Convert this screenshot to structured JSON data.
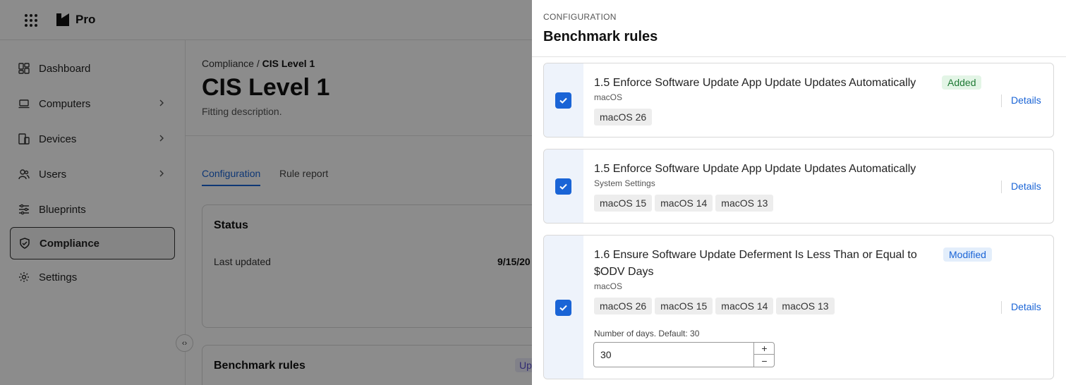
{
  "app": {
    "brand": "Pro"
  },
  "sidebar": {
    "items": [
      {
        "label": "Dashboard",
        "icon": "dashboard-icon",
        "has_children": false,
        "active": false
      },
      {
        "label": "Computers",
        "icon": "laptop-icon",
        "has_children": true,
        "active": false
      },
      {
        "label": "Devices",
        "icon": "devices-icon",
        "has_children": true,
        "active": false
      },
      {
        "label": "Users",
        "icon": "users-icon",
        "has_children": true,
        "active": false
      },
      {
        "label": "Blueprints",
        "icon": "sliders-icon",
        "has_children": false,
        "active": false
      },
      {
        "label": "Compliance",
        "icon": "shield-icon",
        "has_children": false,
        "active": true
      },
      {
        "label": "Settings",
        "icon": "gear-icon",
        "has_children": false,
        "active": false
      }
    ]
  },
  "main": {
    "breadcrumb_parent": "Compliance",
    "breadcrumb_sep": "/",
    "breadcrumb_current": "CIS Level 1",
    "title": "CIS Level 1",
    "description": "Fitting description.",
    "tabs": [
      {
        "label": "Configuration",
        "active": true
      },
      {
        "label": "Rule report",
        "active": false
      }
    ],
    "status_card": {
      "title": "Status",
      "last_updated_label": "Last updated",
      "last_updated_value": "9/15/20"
    },
    "benchmark_card": {
      "title": "Benchmark rules",
      "badge": "Up"
    }
  },
  "drawer": {
    "eyebrow": "CONFIGURATION",
    "title": "Benchmark rules",
    "details_label": "Details",
    "rules": [
      {
        "title": "1.5 Enforce Software Update App Update Updates Automatically",
        "badge": "Added",
        "subtitle": "macOS",
        "tags": [
          "macOS 26"
        ],
        "checked": true
      },
      {
        "title": "1.5 Enforce Software Update App Update Updates Automatically",
        "badge": "",
        "subtitle": "System Settings",
        "tags": [
          "macOS 15",
          "macOS 14",
          "macOS 13"
        ],
        "checked": true
      },
      {
        "title_line1": "1.6 Ensure Software Update Deferment Is Less Than or Equal to",
        "title_line2": "$ODV Days",
        "badge": "Modified",
        "subtitle": "macOS",
        "tags": [
          "macOS 26",
          "macOS 15",
          "macOS 14",
          "macOS 13"
        ],
        "checked": true,
        "field_label": "Number of days. Default: 30",
        "field_value": "30"
      }
    ]
  },
  "colors": {
    "accent": "#1a64d6",
    "added_bg": "#e3f5e6",
    "added_fg": "#1f7a35",
    "modified_bg": "#e3eefb"
  }
}
